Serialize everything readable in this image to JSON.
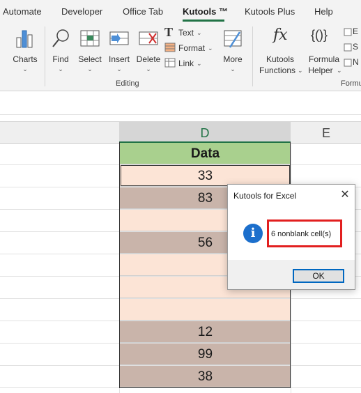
{
  "tabs": [
    "Automate",
    "Developer",
    "Office Tab",
    "Kutools ™",
    "Kutools Plus",
    "Help"
  ],
  "active_tab": "Kutools ™",
  "ribbon": {
    "charts": "Charts",
    "find": "Find",
    "select": "Select",
    "insert": "Insert",
    "delete": "Delete",
    "text": "Text",
    "format": "Format",
    "link": "Link",
    "more": "More",
    "editing_group": "Editing",
    "kutools_functions_1": "Kutools",
    "kutools_functions_2": "Functions",
    "formula_helper_1": "Formula",
    "formula_helper_2": "Helper",
    "formula_group": "Formu",
    "fx_glyph": "fx",
    "braces_glyph": "{()}",
    "e_label": "E",
    "s_label": "S",
    "n_label": "N"
  },
  "columns": {
    "d": "D",
    "e": "E"
  },
  "cells": [
    {
      "value": "Data",
      "style": "hdr"
    },
    {
      "value": "33",
      "style": "light"
    },
    {
      "value": "83",
      "style": "dark"
    },
    {
      "value": "",
      "style": "light"
    },
    {
      "value": "56",
      "style": "dark"
    },
    {
      "value": "",
      "style": "light"
    },
    {
      "value": "",
      "style": "light"
    },
    {
      "value": "",
      "style": "light"
    },
    {
      "value": "12",
      "style": "dark"
    },
    {
      "value": "99",
      "style": "dark"
    },
    {
      "value": "38",
      "style": "dark"
    }
  ],
  "dialog": {
    "title": "Kutools for Excel",
    "close": "✕",
    "info": "i",
    "message": "6 nonblank cell(s)",
    "ok": "OK"
  },
  "colors": {
    "accent": "#217346",
    "header_fill": "#a9d08e",
    "light_fill": "#fce4d6",
    "dark_fill": "#c9b4aa",
    "highlight": "#e21f1f",
    "info": "#1c6fcc"
  }
}
